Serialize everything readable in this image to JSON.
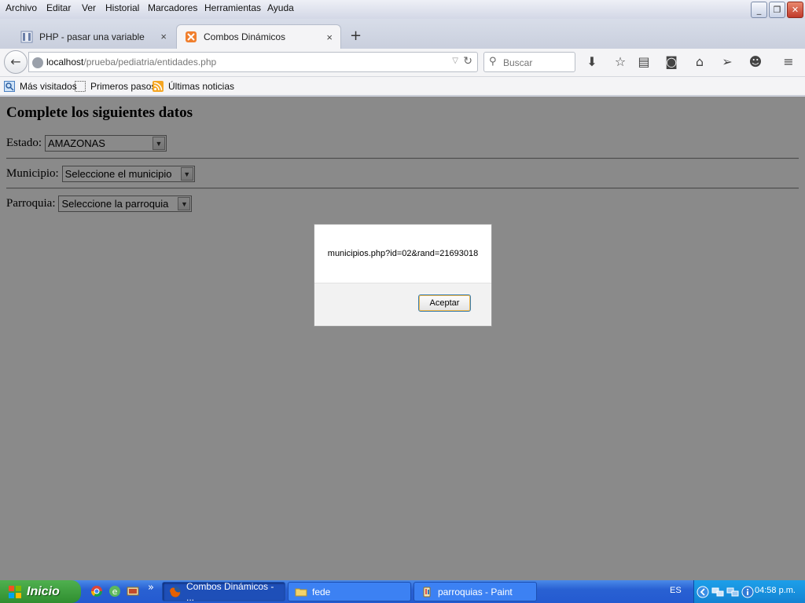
{
  "menu": [
    "Archivo",
    "Editar",
    "Ver",
    "Historial",
    "Marcadores",
    "Herramientas",
    "Ayuda"
  ],
  "tabs": [
    {
      "label": "PHP - pasar una variable",
      "close": "×"
    },
    {
      "label": "Combos Dinámicos",
      "close": "×"
    }
  ],
  "newtab": "+",
  "nav": {
    "back": "←",
    "url_host": "localhost",
    "url_path": "/prueba/pediatria/entidades.php",
    "search_placeholder": "Buscar"
  },
  "bookmarks": [
    "Más visitados",
    "Primeros pasos",
    "Últimas noticias"
  ],
  "page": {
    "title": "Complete los siguientes datos",
    "estado_label": "Estado:",
    "estado_value": "AMAZONAS",
    "municipio_label": "Municipio:",
    "municipio_value": "Seleccione el municipio",
    "parroquia_label": "Parroquia:",
    "parroquia_value": "Seleccione la parroquia"
  },
  "dialog": {
    "message": "municipios.php?id=02&rand=21693018",
    "ok_label": "Aceptar"
  },
  "taskbar": {
    "start_label": "Inicio",
    "more": "»",
    "tasks": [
      "Combos Dinámicos - ...",
      "fede",
      "parroquias - Paint"
    ],
    "language": "ES",
    "clock": "04:58 p.m."
  },
  "colors": {
    "taskbar": "#245ad0",
    "start": "#2f8e2f",
    "overlay": "#7a7a7a"
  }
}
